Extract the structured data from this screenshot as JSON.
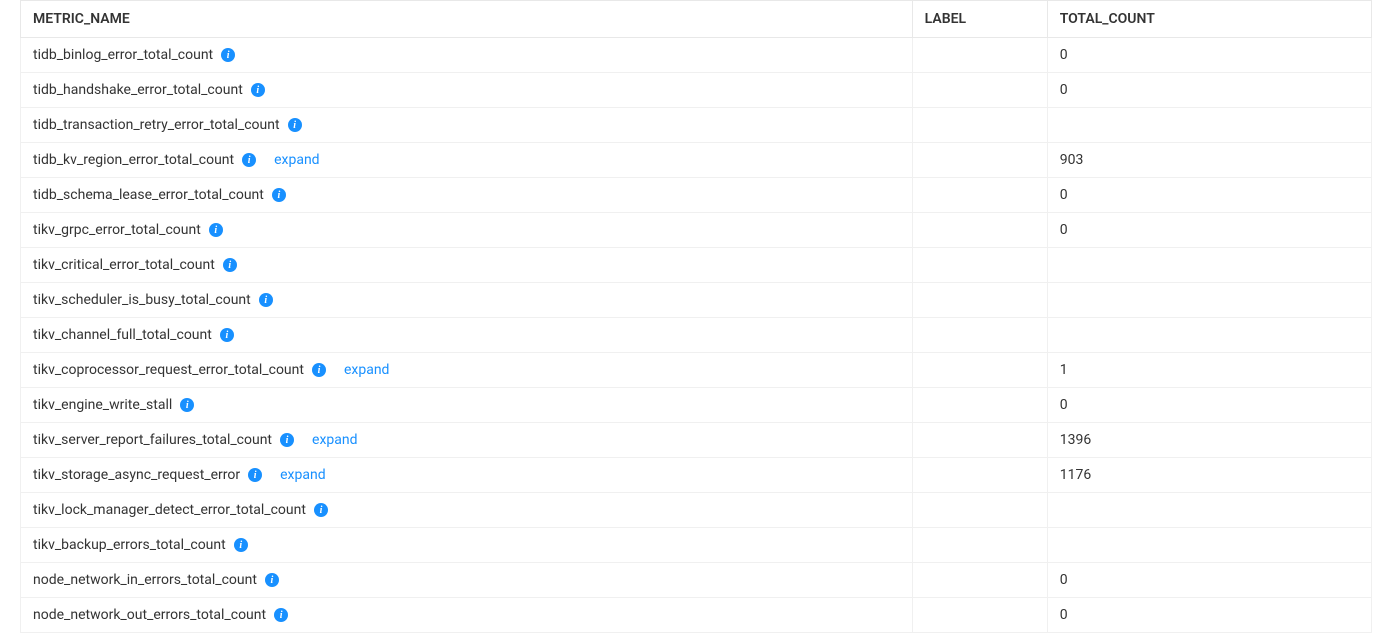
{
  "columns": {
    "metric_name": "METRIC_NAME",
    "label": "LABEL",
    "total_count": "TOTAL_COUNT"
  },
  "expand_label": "expand",
  "rows": [
    {
      "metric": "tidb_binlog_error_total_count",
      "label": "",
      "count": "0",
      "expandable": false
    },
    {
      "metric": "tidb_handshake_error_total_count",
      "label": "",
      "count": "0",
      "expandable": false
    },
    {
      "metric": "tidb_transaction_retry_error_total_count",
      "label": "",
      "count": "",
      "expandable": false
    },
    {
      "metric": "tidb_kv_region_error_total_count",
      "label": "",
      "count": "903",
      "expandable": true
    },
    {
      "metric": "tidb_schema_lease_error_total_count",
      "label": "",
      "count": "0",
      "expandable": false
    },
    {
      "metric": "tikv_grpc_error_total_count",
      "label": "",
      "count": "0",
      "expandable": false
    },
    {
      "metric": "tikv_critical_error_total_count",
      "label": "",
      "count": "",
      "expandable": false
    },
    {
      "metric": "tikv_scheduler_is_busy_total_count",
      "label": "",
      "count": "",
      "expandable": false
    },
    {
      "metric": "tikv_channel_full_total_count",
      "label": "",
      "count": "",
      "expandable": false
    },
    {
      "metric": "tikv_coprocessor_request_error_total_count",
      "label": "",
      "count": "1",
      "expandable": true
    },
    {
      "metric": "tikv_engine_write_stall",
      "label": "",
      "count": "0",
      "expandable": false
    },
    {
      "metric": "tikv_server_report_failures_total_count",
      "label": "",
      "count": "1396",
      "expandable": true
    },
    {
      "metric": "tikv_storage_async_request_error",
      "label": "",
      "count": "1176",
      "expandable": true
    },
    {
      "metric": "tikv_lock_manager_detect_error_total_count",
      "label": "",
      "count": "",
      "expandable": false
    },
    {
      "metric": "tikv_backup_errors_total_count",
      "label": "",
      "count": "",
      "expandable": false
    },
    {
      "metric": "node_network_in_errors_total_count",
      "label": "",
      "count": "0",
      "expandable": false
    },
    {
      "metric": "node_network_out_errors_total_count",
      "label": "",
      "count": "0",
      "expandable": false
    }
  ]
}
